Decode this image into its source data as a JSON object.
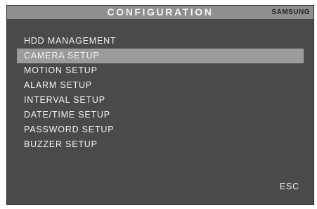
{
  "header": {
    "title": "CONFIGURATION",
    "brand": "SAMSUNG"
  },
  "menu": {
    "selected_index": 1,
    "items": [
      {
        "label": "HDD MANAGEMENT"
      },
      {
        "label": "CAMERA SETUP"
      },
      {
        "label": "MOTION SETUP"
      },
      {
        "label": "ALARM SETUP"
      },
      {
        "label": "INTERVAL SETUP"
      },
      {
        "label": "DATE/TIME SETUP"
      },
      {
        "label": "PASSWORD SETUP"
      },
      {
        "label": "BUZZER SETUP"
      }
    ]
  },
  "footer": {
    "esc_label": "ESC"
  },
  "colors": {
    "screen_background": "#4a4a4a",
    "title_bar": "#8f8f8f",
    "selection_highlight": "#9b9b9b",
    "text": "#f2f2f2"
  }
}
